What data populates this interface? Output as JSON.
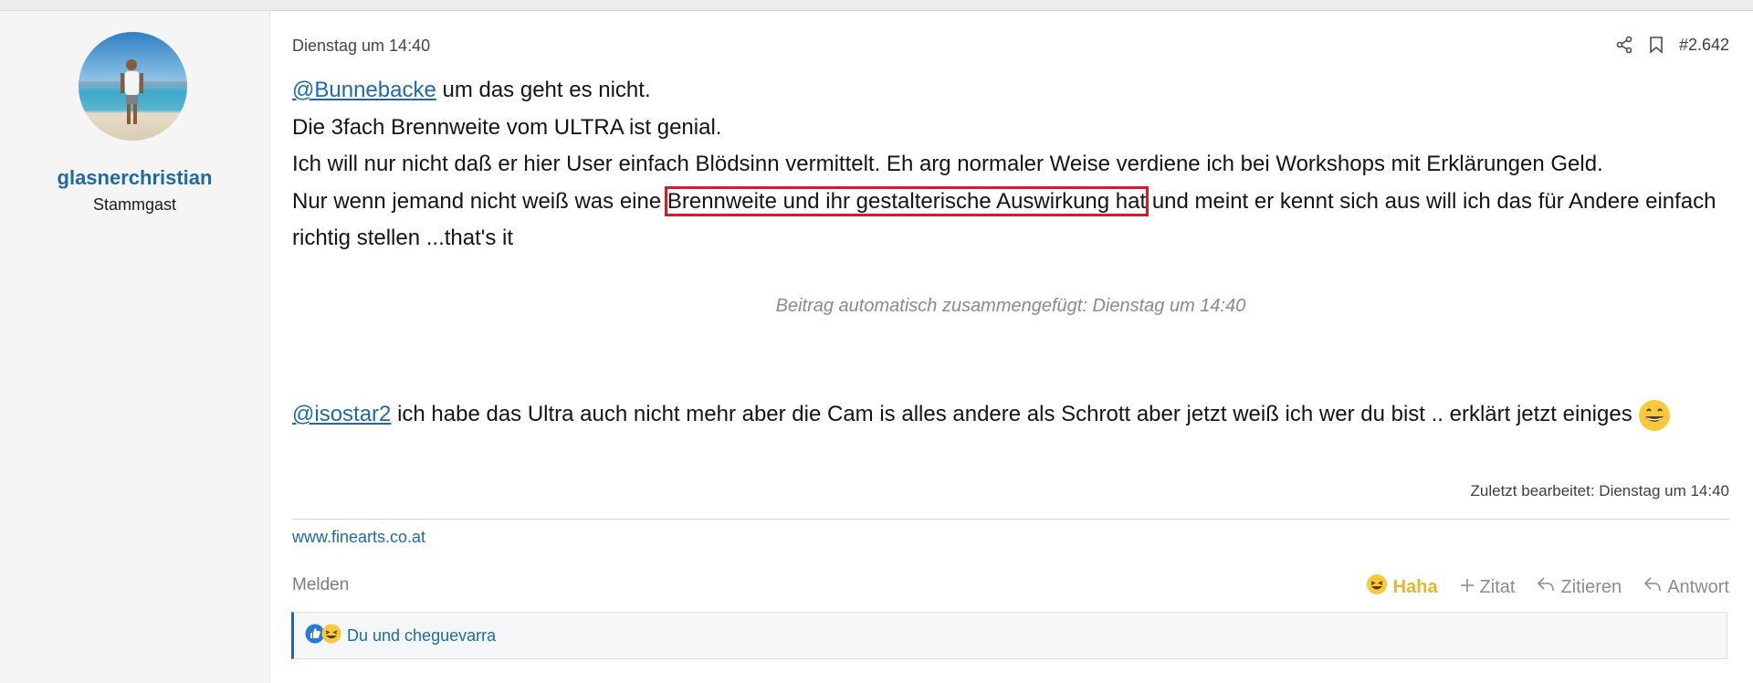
{
  "user": {
    "name": "glasnerchristian",
    "title": "Stammgast"
  },
  "post": {
    "date": "Dienstag um 14:40",
    "number": "#2.642",
    "line1_mention": "@Bunnebacke",
    "line1_rest": " um das geht es nicht.",
    "line2": "Die 3fach Brennweite vom ULTRA ist genial.",
    "line3": "Ich will nur nicht daß er hier User einfach Blödsinn vermittelt. Eh arg normaler Weise verdiene ich bei Workshops mit Erklärungen Geld.",
    "line4_before": "Nur wenn jemand nicht weiß was eine ",
    "line4_highlight": "Brennweite und ihr gestalterische Auswirkung hat",
    "line4_after": " und meint er kennt sich aus will ich das für Andere einfach richtig stellen ...that's it",
    "merge_note": "Beitrag automatisch zusammengefügt: Dienstag um 14:40",
    "line5_mention": "@isostar2",
    "line5_rest": " ich habe das Ultra auch nicht mehr aber die Cam is alles andere als Schrott aber jetzt weiß ich wer du bist .. erklärt jetzt einiges ",
    "edited": "Zuletzt bearbeitet: Dienstag um 14:40",
    "signature": "www.finearts.co.at"
  },
  "footer": {
    "report": "Melden",
    "haha": "Haha",
    "quote_plus": "Zitat",
    "quote": "Zitieren",
    "reply": "Antwort"
  },
  "reactions": {
    "label": "Du und cheguevarra",
    "icons": [
      "like-icon",
      "laugh-icon"
    ]
  },
  "colors": {
    "link": "#1f6aa6",
    "highlight_box": "#d51a2a",
    "haha": "#e6b42e"
  }
}
